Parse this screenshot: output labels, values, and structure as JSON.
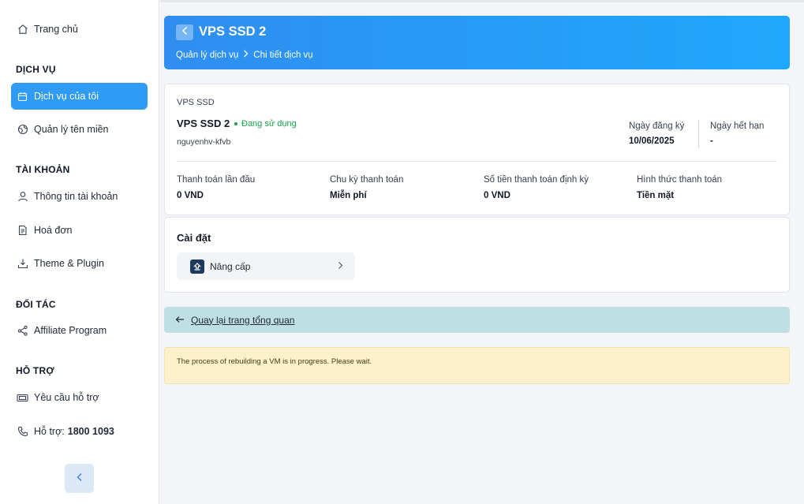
{
  "sidebar": {
    "home": "Trang chủ",
    "sections": {
      "services": "DỊCH VỤ",
      "account": "TÀI KHOẢN",
      "partners": "ĐỐI TÁC",
      "support": "HỖ TRỢ"
    },
    "items": {
      "my_services": "Dịch vụ của tôi",
      "domains": "Quản lý tên miền",
      "account_info": "Thông tin tài khoản",
      "invoices": "Hoá đơn",
      "themes": "Theme & Plugin",
      "affiliate": "Affiliate Program",
      "support_request": "Yêu cầu hỗ trợ",
      "hotline_label": "Hỗ trợ:",
      "hotline_number": "1800 1093"
    }
  },
  "header": {
    "title": "VPS SSD 2",
    "breadcrumb": [
      "Quản lý dịch vụ",
      "Chi tiết dịch vụ"
    ]
  },
  "service": {
    "category": "VPS SSD",
    "name": "VPS SSD 2",
    "status": "Đang sử dụng",
    "username": "nguyenhv-kfvb",
    "register_label": "Ngày đăng ký",
    "register_date": "10/06/2025",
    "expire_label": "Ngày hết hạn",
    "expire_date": "-",
    "billing": [
      {
        "label": "Thanh toán lần đầu",
        "value": "0 VND"
      },
      {
        "label": "Chu kỳ thanh toán",
        "value": "Miễn phí"
      },
      {
        "label": "Số tiền thanh toán định kỳ",
        "value": "0 VND"
      },
      {
        "label": "Hình thức thanh toán",
        "value": "Tiền mặt"
      }
    ]
  },
  "settings": {
    "title": "Cài đặt",
    "upgrade_label": "Nâng cấp"
  },
  "back_link": "Quay lại trang tổng quan",
  "alert": "The process of rebuilding a VM is in progress. Please wait.",
  "colors": {
    "accent": "#2f9bf4",
    "status_green": "#16a34a",
    "alert_bg": "#fdf1cd"
  }
}
